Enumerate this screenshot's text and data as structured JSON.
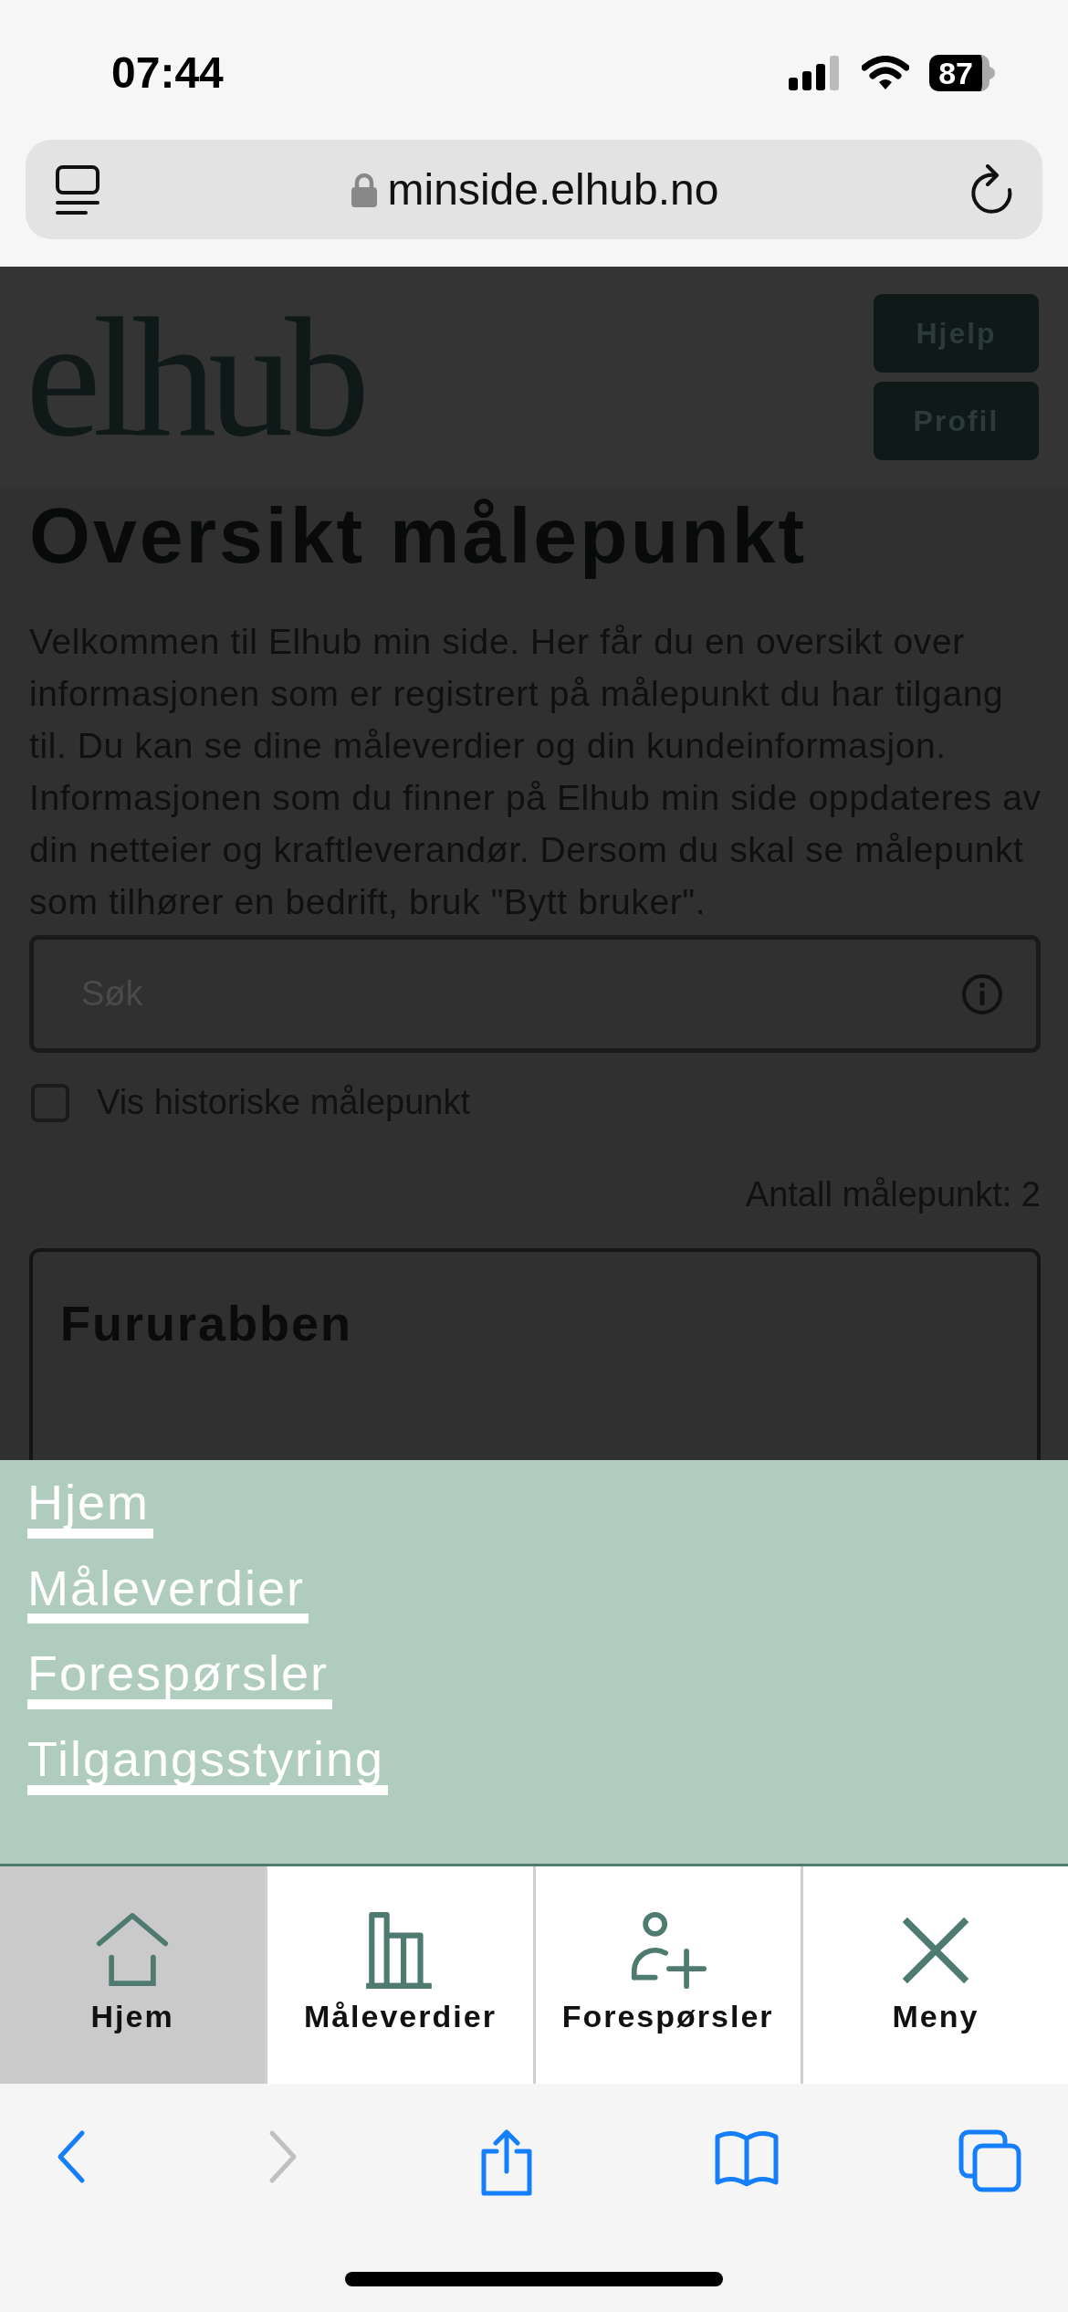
{
  "status_bar": {
    "time": "07:44",
    "battery": "87"
  },
  "browser": {
    "url": "minside.elhub.no"
  },
  "header": {
    "logo": "elhub",
    "buttons": [
      "Hjelp",
      "Profil"
    ]
  },
  "title": "Oversikt målepunkt",
  "intro": "Velkommen til Elhub min side. Her får du en oversikt over informasjonen som er registrert på målepunkt du har tilgang til. Du kan se dine måleverdier og din kundeinformasjon. Informasjonen som du finner på Elhub min side oppdateres av din netteier og kraftleverandør. Dersom du skal se målepunkt som tilhører en bedrift, bruk \"Bytt bruker\".",
  "search": {
    "placeholder": "Søk"
  },
  "history_checkbox": {
    "label": "Vis historiske målepunkt",
    "checked": false
  },
  "count": "Antall målepunkt: 2",
  "cards": [
    {
      "title": "Fururabben"
    }
  ],
  "menu": {
    "items": [
      "Hjem",
      "Måleverdier",
      "Forespørsler",
      "Tilgangsstyring"
    ]
  },
  "bottom_nav": [
    {
      "kind": "home",
      "label": "Hjem",
      "selected": true
    },
    {
      "kind": "chart",
      "label": "Måleverdier",
      "selected": false
    },
    {
      "kind": "person-add",
      "label": "Forespørsler",
      "selected": false
    },
    {
      "kind": "close",
      "label": "Meny",
      "selected": false
    }
  ],
  "toolbar": [
    {
      "kind": "back",
      "disabled": false
    },
    {
      "kind": "forward",
      "disabled": true
    },
    {
      "kind": "share",
      "disabled": false
    },
    {
      "kind": "bookmarks",
      "disabled": false
    },
    {
      "kind": "tabs",
      "disabled": false
    }
  ]
}
